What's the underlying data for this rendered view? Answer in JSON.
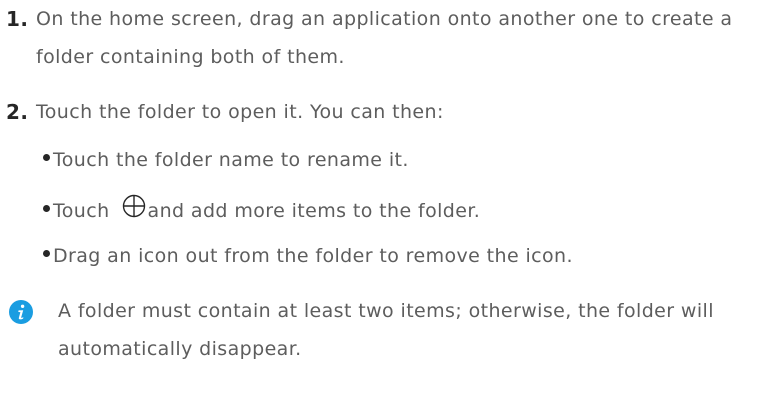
{
  "steps": [
    {
      "number": "1.",
      "lines": [
        "On the home screen, drag an application onto another one to create a",
        "folder containing both of them."
      ]
    },
    {
      "number": "2.",
      "lines": [
        "Touch the folder to open it. You can then:"
      ],
      "bullets": [
        {
          "text": "Touch the folder name to rename it."
        },
        {
          "before": "Touch",
          "icon": "add-circle-icon",
          "after": "and add more items to the folder."
        },
        {
          "text": "Drag an icon out from the folder to remove the icon."
        }
      ]
    }
  ],
  "note": {
    "icon": "info-icon",
    "icon_color": "#1a9de1",
    "lines": [
      "A folder must contain at least two items; otherwise, the folder will",
      "automatically disappear."
    ]
  },
  "colors": {
    "text": "#5d5d5d",
    "number": "#262626"
  }
}
